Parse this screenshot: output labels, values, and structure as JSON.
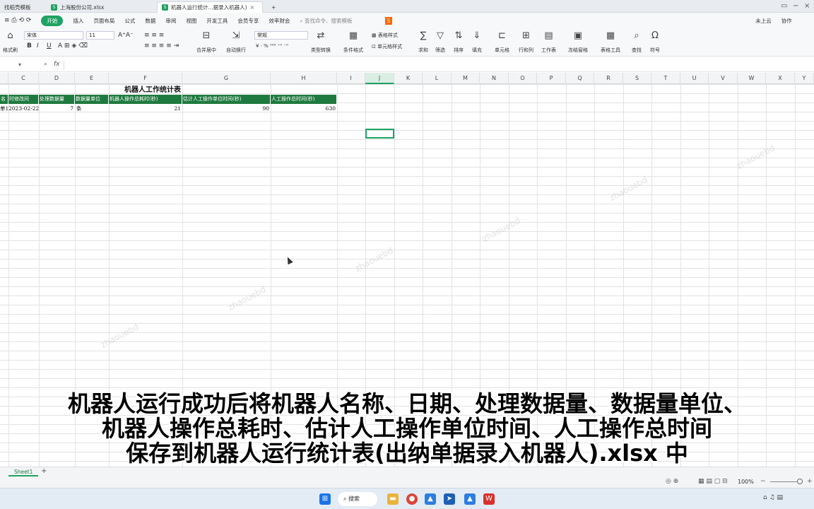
{
  "tabs": [
    {
      "label": "找稻壳模板"
    },
    {
      "label": "上海股份公司.xlsx"
    },
    {
      "label": "机器人运行统计...据录入机器人)"
    }
  ],
  "menu": {
    "start": "开始",
    "items": [
      "插入",
      "页面布局",
      "公式",
      "数据",
      "审阅",
      "视图",
      "开发工具",
      "会员专享",
      "效率财会"
    ],
    "search_placeholder": "查找命令、搜索模板",
    "unsaved": "未上云",
    "collab": "协作"
  },
  "ribbon": {
    "format_painter": "格式刷",
    "font": "宋体",
    "size": "11",
    "number_format": "常规",
    "merge": "合并居中",
    "wrap": "自动换行",
    "type_convert": "类型转换",
    "table_style": "表格样式",
    "conditional": "条件格式",
    "cell_style": "单元格样式",
    "sum": "求和",
    "filter": "筛选",
    "sort": "排序",
    "fill": "填充",
    "cell": "单元格",
    "rowcol": "行和列",
    "worksheet": "工作表",
    "freeze": "冻结窗格",
    "table_tools": "表格工具",
    "find": "查找",
    "symbol": "符号"
  },
  "formula_bar": {
    "fx": "fx"
  },
  "columns": [
    "C",
    "D",
    "E",
    "F",
    "G",
    "H",
    "I",
    "J",
    "K",
    "L",
    "M",
    "N",
    "O",
    "P",
    "Q",
    "R",
    "S",
    "T",
    "U",
    "V",
    "W",
    "X",
    "Y"
  ],
  "sheet": {
    "title": "机器人工作统计表",
    "headers": [
      "名",
      "时修改间",
      "处理数据量",
      "数据量单位",
      "机器人操作总耗时(秒)",
      "估计人工操作单位时间(秒)",
      "人工操作总时间(秒)"
    ],
    "row": [
      "单1",
      "2023-02-22",
      "7",
      "条",
      "21",
      "90",
      "630"
    ]
  },
  "watermark": "zhaouebd",
  "caption": [
    "机器人运行成功后将机器人名称、日期、处理数据量、数据量单位、",
    "机器人操作总耗时、估计人工操作单位时间、人工操作总时间",
    "保存到机器人运行统计表(出纳单据录入机器人).xlsx 中"
  ],
  "sheet_tab": "Sheet1",
  "zoom": "100%",
  "taskbar": {
    "search": "搜索"
  }
}
